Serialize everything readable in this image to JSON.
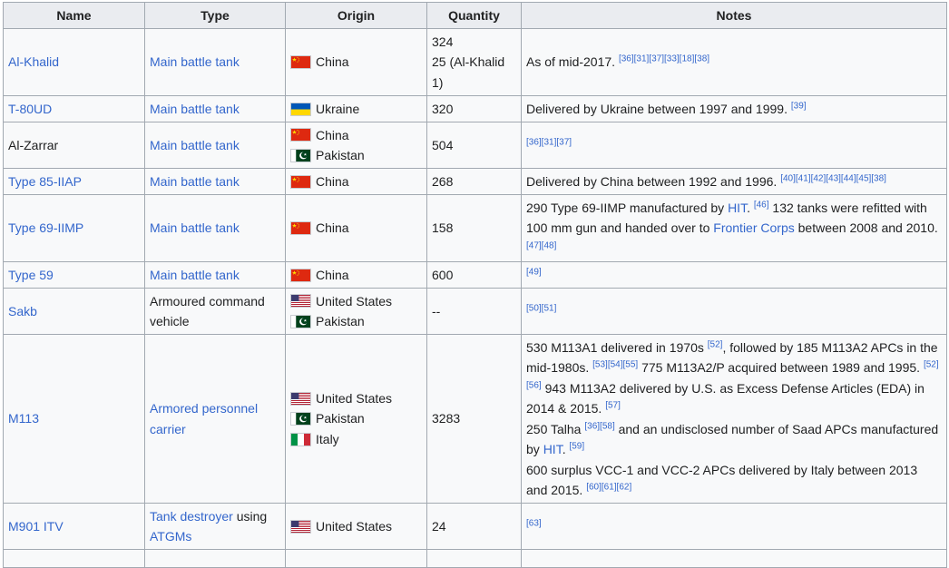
{
  "headers": {
    "name": "Name",
    "type": "Type",
    "origin": "Origin",
    "quantity": "Quantity",
    "notes": "Notes"
  },
  "rows": [
    {
      "name": "Al-Khalid",
      "type": "Main battle tank",
      "origins": [
        "China"
      ],
      "quantity": [
        "324",
        "25 (Al-Khalid",
        "1)"
      ],
      "notes": {
        "text": "As of mid-2017.",
        "refs": "[36][31][37][33][18][38]"
      }
    },
    {
      "name": "T-80UD",
      "type": "Main battle tank",
      "origins": [
        "Ukraine"
      ],
      "quantity": [
        "320"
      ],
      "notes": {
        "text": "Delivered by Ukraine between 1997 and 1999.",
        "refs": "[39]"
      }
    },
    {
      "name": "Al-Zarrar",
      "type": "Main battle tank",
      "origins": [
        "China",
        "Pakistan"
      ],
      "quantity": [
        "504"
      ],
      "notes": {
        "text": "",
        "refs": "[36][31][37]"
      }
    },
    {
      "name": "Type 85-IIAP",
      "type": "Main battle tank",
      "origins": [
        "China"
      ],
      "quantity": [
        "268"
      ],
      "notes": {
        "text": "Delivered by China between 1992 and 1996.",
        "refs": "[40][41][42][43][44][45][38]"
      }
    },
    {
      "name": "Type 69-IIMP",
      "type": "Main battle tank",
      "origins": [
        "China"
      ],
      "quantity": [
        "158"
      ],
      "notes": {
        "p1": "290 Type 69-IIMP manufactured by",
        "link1": "HIT",
        "ref1": "[46]",
        "p2": "132 tanks were refitted with 100 mm gun and handed over to",
        "link2": "Frontier Corps",
        "p3": "between 2008 and 2010.",
        "ref2": "[47][48]"
      }
    },
    {
      "name": "Type 59",
      "type": "Main battle tank",
      "origins": [
        "China"
      ],
      "quantity": [
        "600"
      ],
      "notes": {
        "text": "",
        "refs": "[49]"
      }
    },
    {
      "name": "Sakb",
      "type": "Armoured command vehicle",
      "origins": [
        "United States",
        "Pakistan"
      ],
      "quantity": [
        "--"
      ],
      "notes": {
        "text": "",
        "refs": "[50][51]"
      }
    },
    {
      "name": "M113",
      "type": "Armored personnel carrier",
      "origins": [
        "United States",
        "Pakistan",
        "Italy"
      ],
      "quantity": [
        "3283"
      ],
      "notes": {
        "a1": "530 M113A1 delivered in 1970s",
        "r1": "[52]",
        "a2": ", followed by 185 M113A2 APCs in the mid-1980s.",
        "r2": "[53][54][55]",
        "a3": "775 M113A2/P acquired between 1989 and 1995.",
        "r3": "[52][56]",
        "a4": "943 M113A2 delivered by U.S. as Excess Defense Articles (EDA) in 2014 & 2015.",
        "r4": "[57]",
        "b1": "250 Talha",
        "r5": "[36][58]",
        "b2": "and an undisclosed number of Saad APCs manufactured by",
        "blink": "HIT",
        "r6": "[59]",
        "c1": "600 surplus VCC-1 and VCC-2 APCs delivered by Italy between 2013 and 2015.",
        "r7": "[60][61][62]"
      }
    },
    {
      "name": "M901 ITV",
      "type_link": "Tank destroyer",
      "type_mid": "using",
      "type_link2": "ATGMs",
      "origins": [
        "United States"
      ],
      "quantity": [
        "24"
      ],
      "notes": {
        "text": "",
        "refs": "[63]"
      }
    }
  ],
  "colors": {
    "link": "#3366cc",
    "text": "#202122",
    "header_bg": "#eaecf0",
    "cell_bg": "#f8f9fa",
    "border": "#a2a9b1"
  },
  "flag_icons": {
    "China": "china-flag-icon",
    "Ukraine": "ukraine-flag-icon",
    "Pakistan": "pakistan-flag-icon",
    "United States": "us-flag-icon",
    "Italy": "italy-flag-icon"
  }
}
